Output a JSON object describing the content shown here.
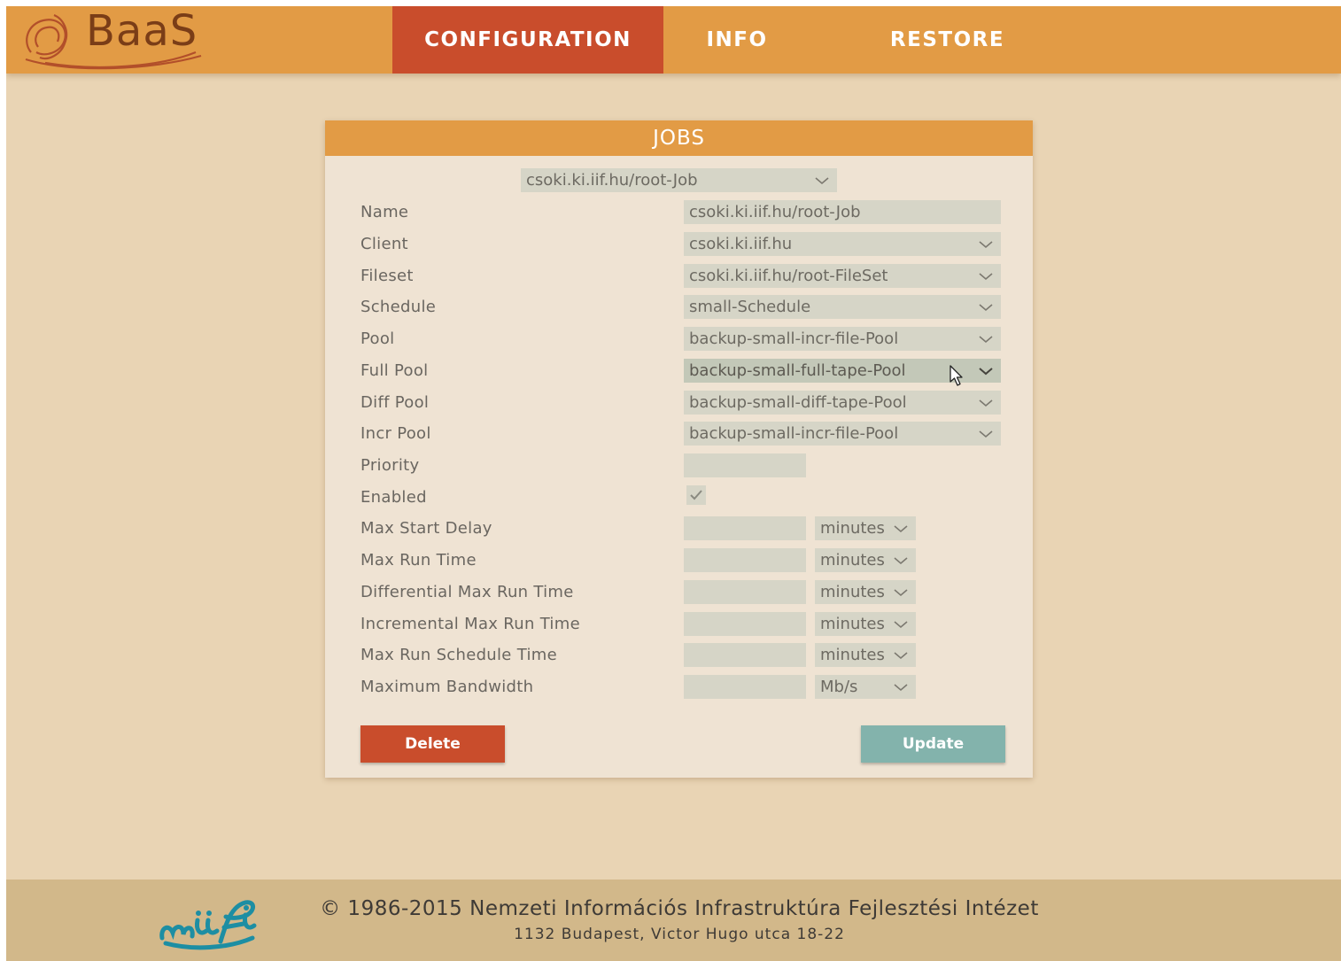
{
  "app": {
    "logo_text": "BaaS"
  },
  "nav": {
    "tabs": [
      {
        "label": "CONFIGURATION",
        "active": true
      },
      {
        "label": "INFO",
        "active": false
      },
      {
        "label": "RESTORE",
        "active": false
      }
    ]
  },
  "jobs": {
    "title": "JOBS",
    "job_selector": "csoki.ki.iif.hu/root-Job",
    "fields": {
      "name": {
        "label": "Name",
        "value": "csoki.ki.iif.hu/root-Job"
      },
      "client": {
        "label": "Client",
        "value": "csoki.ki.iif.hu"
      },
      "fileset": {
        "label": "Fileset",
        "value": "csoki.ki.iif.hu/root-FileSet"
      },
      "schedule": {
        "label": "Schedule",
        "value": "small-Schedule"
      },
      "pool": {
        "label": "Pool",
        "value": "backup-small-incr-file-Pool"
      },
      "full_pool": {
        "label": "Full Pool",
        "value": "backup-small-full-tape-Pool"
      },
      "diff_pool": {
        "label": "Diff Pool",
        "value": "backup-small-diff-tape-Pool"
      },
      "incr_pool": {
        "label": "Incr Pool",
        "value": "backup-small-incr-file-Pool"
      },
      "priority": {
        "label": "Priority",
        "value": ""
      },
      "enabled": {
        "label": "Enabled",
        "checked": true
      },
      "max_start_delay": {
        "label": "Max Start Delay",
        "value": "",
        "unit": "minutes"
      },
      "max_run_time": {
        "label": "Max Run Time",
        "value": "",
        "unit": "minutes"
      },
      "diff_max_run_time": {
        "label": "Differential Max Run Time",
        "value": "",
        "unit": "minutes"
      },
      "incr_max_run_time": {
        "label": "Incremental Max Run Time",
        "value": "",
        "unit": "minutes"
      },
      "max_run_sched_time": {
        "label": "Max Run Schedule Time",
        "value": "",
        "unit": "minutes"
      },
      "max_bandwidth": {
        "label": "Maximum Bandwidth",
        "value": "",
        "unit": "Mb/s"
      }
    },
    "delete_label": "Delete",
    "update_label": "Update"
  },
  "footer": {
    "copyright": "© 1986-2015 Nemzeti Információs Infrastruktúra Fejlesztési Intézet",
    "address": "1132 Budapest, Victor Hugo utca 18-22"
  },
  "colors": {
    "header": "#e29b45",
    "active_tab": "#c94d2c",
    "background": "#e9d4b4",
    "panel": "#efe3d3",
    "field": "#d6d5c7",
    "delete": "#c94d2c",
    "update": "#83b3ac",
    "footer": "#d2b88a"
  }
}
